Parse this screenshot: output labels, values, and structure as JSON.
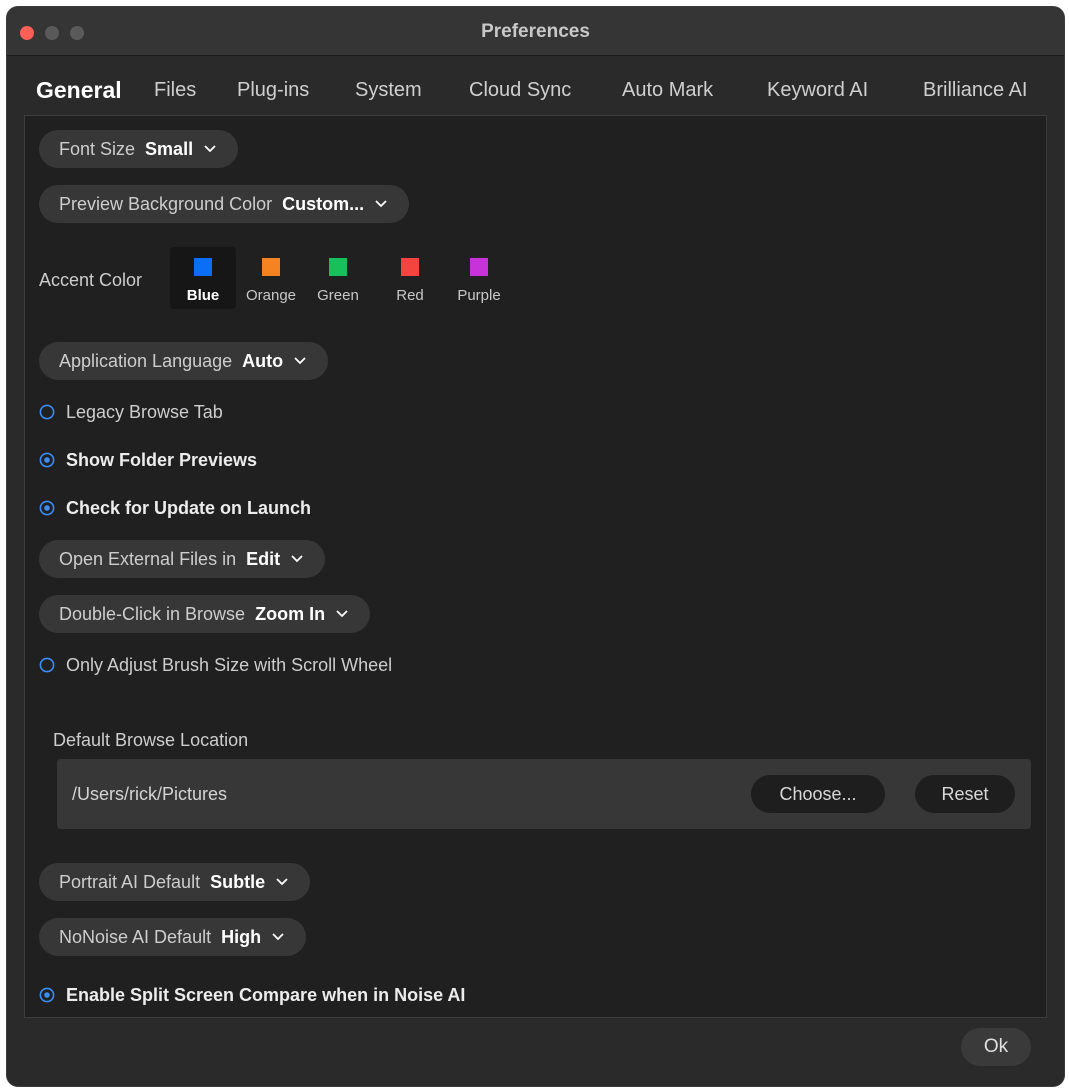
{
  "window": {
    "title": "Preferences"
  },
  "tabs": [
    {
      "label": "General"
    },
    {
      "label": "Files"
    },
    {
      "label": "Plug-ins"
    },
    {
      "label": "System"
    },
    {
      "label": "Cloud Sync"
    },
    {
      "label": "Auto Mark"
    },
    {
      "label": "Keyword AI"
    },
    {
      "label": "Brilliance AI"
    }
  ],
  "general": {
    "font_size": {
      "label": "Font Size",
      "value": "Small"
    },
    "preview_bg": {
      "label": "Preview Background Color",
      "value": "Custom..."
    },
    "accent": {
      "label": "Accent Color",
      "options": [
        {
          "name": "Blue",
          "color": "#0a6ef7"
        },
        {
          "name": "Orange",
          "color": "#f5831f"
        },
        {
          "name": "Green",
          "color": "#18c05c"
        },
        {
          "name": "Red",
          "color": "#f4443f"
        },
        {
          "name": "Purple",
          "color": "#c733d8"
        }
      ],
      "selected": "Blue"
    },
    "language": {
      "label": "Application Language",
      "value": "Auto"
    },
    "legacy_browse": {
      "label": "Legacy Browse Tab",
      "checked": false
    },
    "folder_previews": {
      "label": "Show Folder Previews",
      "checked": true
    },
    "check_update": {
      "label": "Check for Update on Launch",
      "checked": true
    },
    "open_external": {
      "label": "Open External Files in",
      "value": "Edit"
    },
    "double_click": {
      "label": "Double-Click in Browse",
      "value": "Zoom In"
    },
    "brush_scroll": {
      "label": "Only Adjust Brush Size with Scroll Wheel",
      "checked": false
    },
    "browse_location": {
      "label": "Default Browse Location",
      "path": "/Users/rick/Pictures",
      "choose_label": "Choose...",
      "reset_label": "Reset"
    },
    "portrait_ai": {
      "label": "Portrait AI Default",
      "value": "Subtle"
    },
    "nonoise_ai": {
      "label": "NoNoise AI Default",
      "value": "High"
    },
    "split_screen": {
      "label": "Enable Split Screen Compare when in Noise AI",
      "checked": true
    }
  },
  "footer": {
    "ok_label": "Ok"
  },
  "colors": {
    "accent": "#3b8df5",
    "window_bg": "#2a2a2a",
    "panel_bg": "#202020",
    "pill_bg": "#373737"
  }
}
